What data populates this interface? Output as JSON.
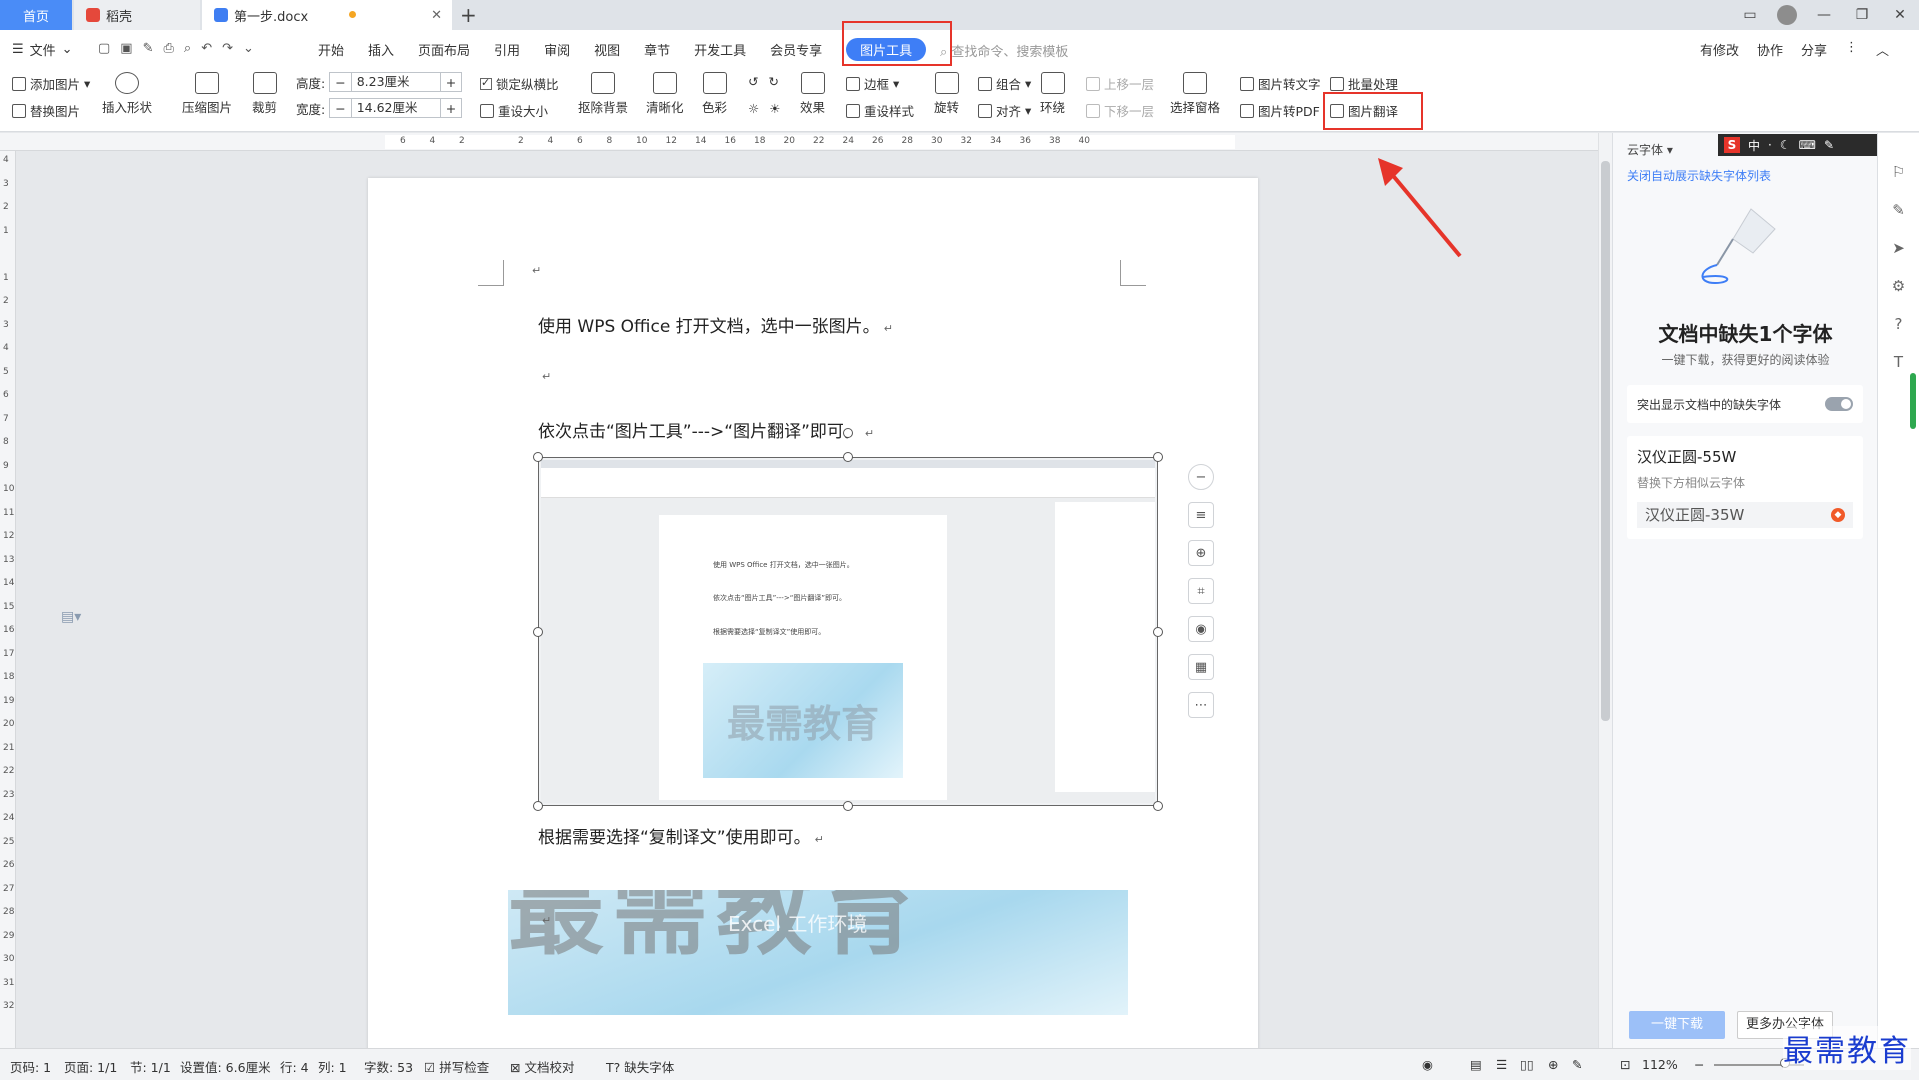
{
  "tabs": {
    "home": "首页",
    "wps": "稻壳",
    "doc": "第一步.docx"
  },
  "menu": {
    "file": "文件",
    "items": [
      "开始",
      "插入",
      "页面布局",
      "引用",
      "审阅",
      "视图",
      "章节",
      "开发工具",
      "会员专享",
      "图片工具"
    ],
    "active": "图片工具",
    "search_placeholder": "查找命令、搜索模板",
    "right": [
      "有修改",
      "协作",
      "分享"
    ]
  },
  "ribbon": {
    "add_image": "添加图片",
    "replace_image": "替换图片",
    "insert_shape": "插入形状",
    "compress": "压缩图片",
    "crop": "裁剪",
    "height_label": "高度:",
    "height_value": "8.23厘米",
    "width_label": "宽度:",
    "width_value": "14.62厘米",
    "lock_ratio": "锁定纵横比",
    "reset_size": "重设大小",
    "remove_bg": "抠除背景",
    "sharpen": "清晰化",
    "color": "色彩",
    "effect": "效果",
    "border": "边框",
    "reset_style": "重设样式",
    "rotate": "旋转",
    "group": "组合",
    "align": "对齐",
    "wrap": "环绕",
    "bring_forward": "上移一层",
    "send_backward": "下移一层",
    "selection_pane": "选择窗格",
    "img_to_text": "图片转文字",
    "img_to_pdf": "图片转PDF",
    "batch": "批量处理",
    "translate": "图片翻译"
  },
  "ruler_top": [
    "6",
    "4",
    "2",
    "",
    "2",
    "4",
    "6",
    "8",
    "10",
    "12",
    "14",
    "16",
    "18",
    "20",
    "22",
    "24",
    "26",
    "28",
    "30",
    "32",
    "34",
    "36",
    "38",
    "40"
  ],
  "ruler_left": [
    "4",
    "3",
    "2",
    "1",
    "",
    "1",
    "2",
    "3",
    "4",
    "5",
    "6",
    "7",
    "8",
    "9",
    "10",
    "11",
    "12",
    "13",
    "14",
    "15",
    "16",
    "17",
    "18",
    "19",
    "20",
    "21",
    "22",
    "23",
    "24",
    "25",
    "26",
    "27",
    "28",
    "29",
    "30",
    "31",
    "32"
  ],
  "document": {
    "p1": "使用 WPS Office 打开文档，选中一张图片。",
    "p2": "依次点击“图片工具”--->“图片翻译”即可。",
    "p3": "根据需要选择“复制译文”使用即可。",
    "mini_p1": "使用 WPS Office 打开文档，选中一张图片。",
    "mini_p2": "依次点击“图片工具”--->“图片翻译”即可。",
    "mini_p3": "根据需要选择“复制译文”使用即可。",
    "mini_pic_text": "最需教育",
    "banner_big": "最需教育",
    "banner_sub": "Excel 工作环境"
  },
  "panel": {
    "header": "云字体",
    "close_link": "关闭自动展示缺失字体列表",
    "title": "文档中缺失1个字体",
    "subtitle": "一键下载，获得更好的阅读体验",
    "highlight_label": "突出显示文档中的缺失字体",
    "font_name": "汉仪正圆-55W",
    "replace_hint": "替换下方相似云字体",
    "similar_font": "汉仪正圆-35W",
    "download_btn": "一键下载",
    "more_btn": "更多办公字体",
    "ime": [
      "S",
      "中",
      "·",
      "。"
    ]
  },
  "status": {
    "page_no": "页码: 1",
    "pages": "页面: 1/1",
    "section": "节: 1/1",
    "setting": "设置值: 6.6厘米",
    "row": "行: 4",
    "col": "列: 1",
    "words": "字数: 53",
    "spell": "拼写检查",
    "proof": "文档校对",
    "missing_font": "缺失字体",
    "zoom": "112%"
  },
  "watermark": "最需教育",
  "colors": {
    "accent": "#3e7ef6",
    "highlight": "#e6342a",
    "home_tab": "#4a8cf7"
  }
}
